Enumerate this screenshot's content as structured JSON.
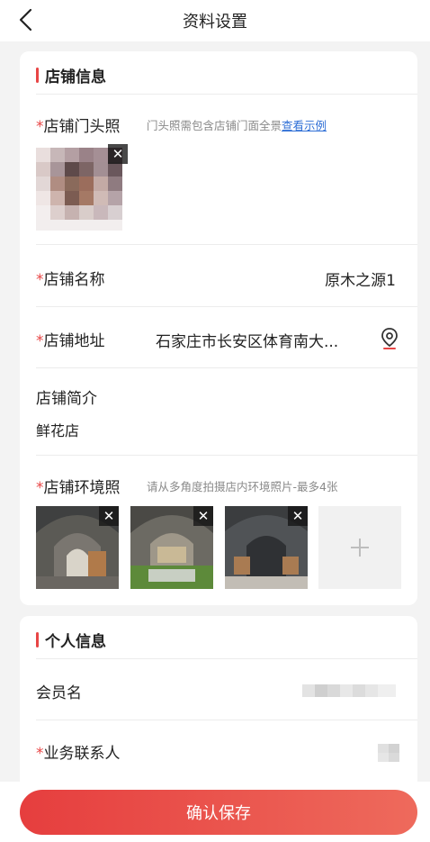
{
  "nav": {
    "title": "资料设置"
  },
  "store_info": {
    "section_title": "店铺信息",
    "storefront_photo": {
      "required_mark": "*",
      "label": "店铺门头照",
      "hint": "门头照需包含店铺门面全景",
      "example_link": "查看示例"
    },
    "store_name": {
      "required_mark": "*",
      "label": "店铺名称",
      "value": "原木之源1"
    },
    "store_address": {
      "required_mark": "*",
      "label": "店铺地址",
      "value": "石家庄市长安区体育南大..."
    },
    "store_intro": {
      "label": "店铺简介",
      "value": "鲜花店"
    },
    "environment_photos": {
      "required_mark": "*",
      "label": "店铺环境照",
      "hint": "请从多角度拍摄店内环境照片-最多4张",
      "count": 3
    }
  },
  "personal_info": {
    "section_title": "个人信息",
    "member_name": {
      "label": "会员名"
    },
    "business_contact": {
      "required_mark": "*",
      "label": "业务联系人"
    }
  },
  "icons": {
    "back": "chevron-left-icon",
    "close": "close-icon",
    "location": "location-pin-icon",
    "add": "plus-icon"
  },
  "colors": {
    "accent": "#e84545",
    "link": "#2f6fd6",
    "button_start": "#e63e3e",
    "button_end": "#ee6a5c"
  },
  "actions": {
    "save_label": "确认保存",
    "close_glyph": "✕"
  }
}
